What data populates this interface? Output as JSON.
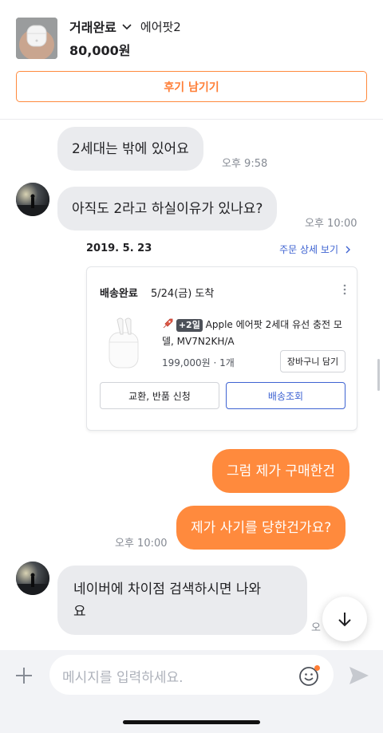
{
  "header": {
    "status": "거래완료",
    "product_name": "에어팟2",
    "price": "80,000원",
    "review_button": "후기 남기기"
  },
  "messages": [
    {
      "text": "2세대는 밖에 있어요",
      "time": "오후 9:58",
      "sender": "other"
    },
    {
      "text": "아직도 2라고 하실이유가 있나요?",
      "time": "오후 10:00",
      "sender": "other"
    },
    {
      "text": "그럼 제가 구매한건",
      "sender": "me"
    },
    {
      "text": "제가 사기를 당한건가요?",
      "time": "오후 10:00",
      "sender": "me"
    },
    {
      "text_line1": "네이버에 차이점 검색하시면 나와",
      "text_line2": "요",
      "time": "오",
      "sender": "other"
    }
  ],
  "order": {
    "date": "2019. 5. 23",
    "detail_link": "주문 상세 보기",
    "status": "배송완료",
    "arrival": "5/24(금) 도착",
    "badge": "+2일",
    "product_title": "Apple 에어팟 2세대 유선 충전 모델, MV7N2KH/A",
    "price_qty": "199,000원 · 1개",
    "cart_button": "장바구니 담기",
    "return_button": "교환, 반품 신청",
    "tracking_button": "배송조회"
  },
  "input": {
    "placeholder": "메시지를 입력하세요."
  },
  "colors": {
    "accent": "#ff8a3d",
    "link_blue": "#3e63d2",
    "bubble_gray": "#eaebee"
  }
}
